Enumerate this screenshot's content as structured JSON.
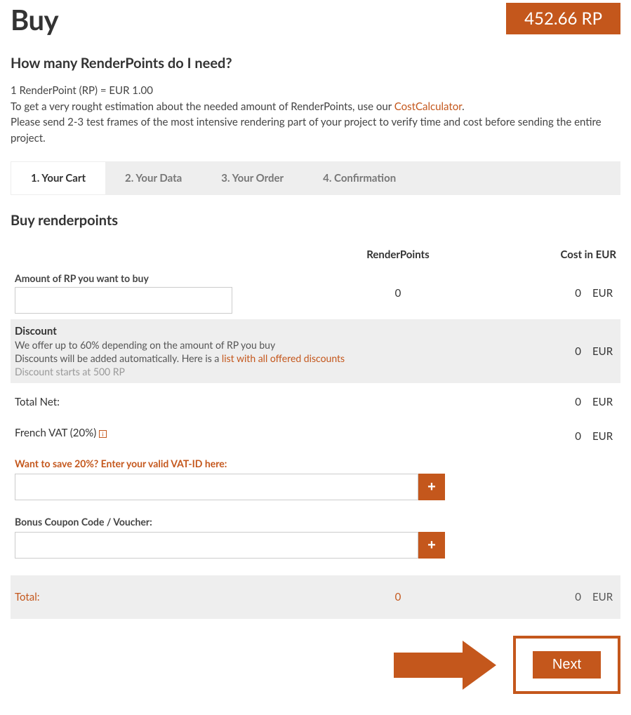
{
  "header": {
    "title": "Buy",
    "balance": "452.66 RP"
  },
  "intro": {
    "heading": "How many RenderPoints do I need?",
    "line1": "1 RenderPoint (RP) = EUR 1.00",
    "line2a": "To get a very rought estimation about the needed amount of RenderPoints, use our ",
    "calc_link": "CostCalculator",
    "line2b": ".",
    "line3": "Please send 2-3 test frames of the most intensive rendering part of your project to verify time and cost before sending the entire project."
  },
  "tabs": {
    "t1": "1. Your Cart",
    "t2": "2. Your Data",
    "t3": "3. Your Order",
    "t4": "4. Confirmation"
  },
  "section_title": "Buy renderpoints",
  "cols": {
    "rp": "RenderPoints",
    "cost": "Cost in EUR"
  },
  "amount": {
    "label": "Amount of RP you want to buy",
    "value": "",
    "rp": "0",
    "cost": "0",
    "unit": "EUR"
  },
  "discount": {
    "head": "Discount",
    "sub1": "We offer up to 60% depending on the amount of RP you buy",
    "sub2a": "Discounts will be added automatically. Here is a ",
    "sub2link": "list with all offered discounts",
    "note": "Discount starts at 500 RP",
    "cost": "0",
    "unit": "EUR"
  },
  "net": {
    "label": "Total Net:",
    "cost": "0",
    "unit": "EUR"
  },
  "vat": {
    "label": "French VAT (20%)",
    "cost": "0",
    "unit": "EUR"
  },
  "vatid": {
    "label": "Want to save 20%? Enter your valid VAT-ID here:",
    "value": ""
  },
  "coupon": {
    "label": "Bonus Coupon Code / Voucher:",
    "value": ""
  },
  "total": {
    "label": "Total:",
    "rp": "0",
    "cost": "0",
    "unit": "EUR"
  },
  "next": "Next",
  "plus": "+"
}
